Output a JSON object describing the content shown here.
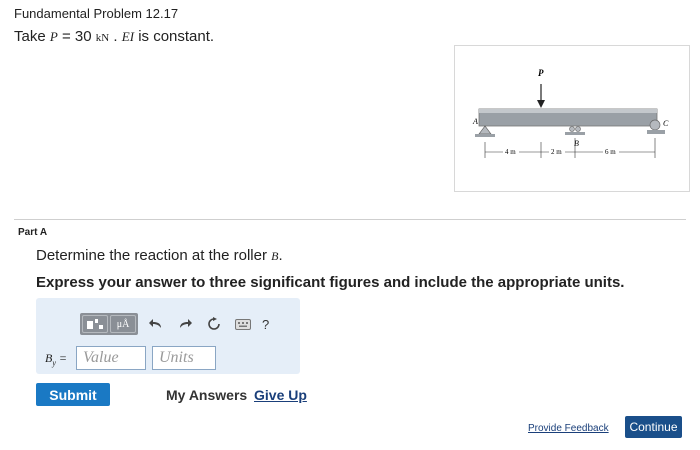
{
  "problem": {
    "title": "Fundamental Problem 12.17",
    "statement_prefix": "Take",
    "load_var": "P",
    "equals": "= 30",
    "load_unit": "kN",
    "separator": ".",
    "stiffness_var": "EI",
    "statement_suffix": "is constant."
  },
  "figure": {
    "load_label": "P",
    "support_a_label": "A",
    "support_b_label": "B",
    "support_c_label": "C",
    "dim_1": "4 m",
    "dim_2": "2 m",
    "dim_3": "6 m"
  },
  "part": {
    "label": "Part A",
    "question_prefix": "Determine the reaction at the roller",
    "question_var": "B",
    "question_suffix": ".",
    "instruction": "Express your answer to three significant figures and include the appropriate units."
  },
  "answer": {
    "label_var": "B",
    "label_sub": "y",
    "label_eq": "=",
    "value_placeholder": "Value",
    "units_placeholder": "Units",
    "mu_button": "μÅ",
    "help": "?"
  },
  "actions": {
    "submit": "Submit",
    "my_answers": "My Answers",
    "give_up": "Give Up",
    "feedback": "Provide Feedback",
    "continue": "Continue"
  },
  "colors": {
    "submit_bg": "#1a79c4",
    "continue_bg": "#1a4f8a",
    "answer_box_bg": "#e5eef8",
    "link": "#1a3f7a"
  }
}
